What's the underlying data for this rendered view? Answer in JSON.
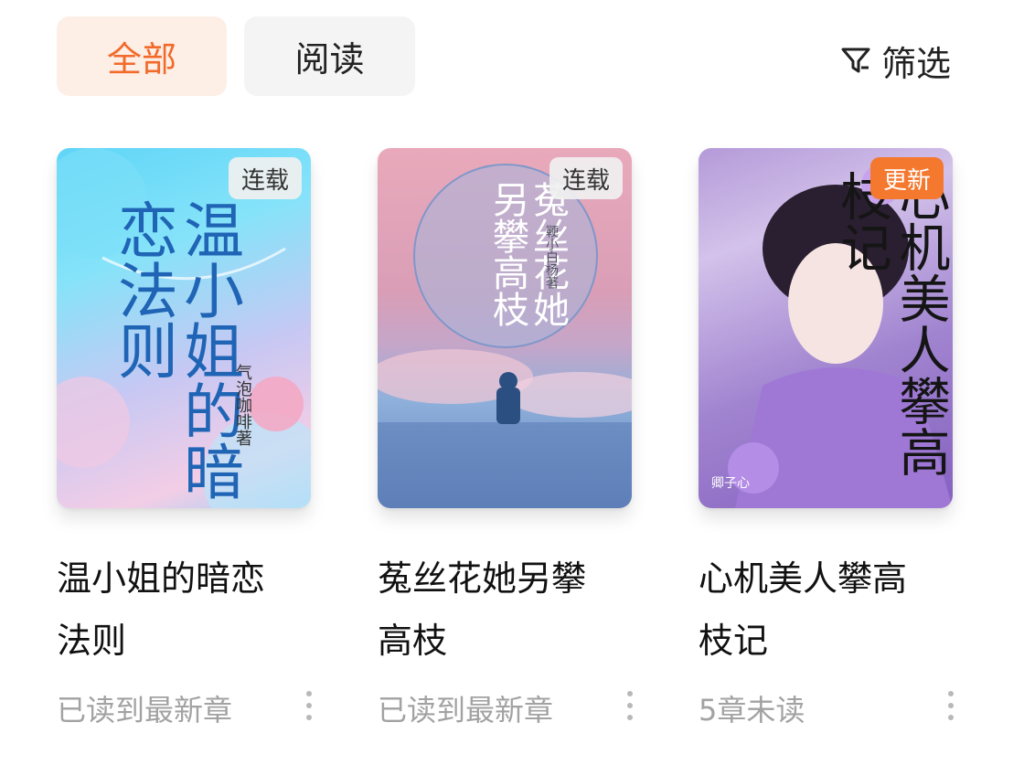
{
  "tabs": [
    {
      "label": "全部",
      "active": true
    },
    {
      "label": "阅读",
      "active": false
    }
  ],
  "filter": {
    "label": "筛选",
    "icon": "filter-icon"
  },
  "colors": {
    "accent": "#f26a2a",
    "update_badge": "#f5782f"
  },
  "books": [
    {
      "badge": "连载",
      "cover_title": "温小姐的暗恋法则",
      "cover_author": "气泡咖啡著",
      "title_line1": "温小姐的暗恋",
      "title_line2": "法则",
      "status": "已读到最新章"
    },
    {
      "badge": "连载",
      "cover_title": "菟丝花她另攀高枝",
      "cover_author": "鞕小白杨著",
      "title_line1": "菟丝花她另攀",
      "title_line2": "高枝",
      "status": "已读到最新章"
    },
    {
      "badge": "更新",
      "cover_title": "心机美人攀高枝记",
      "cover_author": "卿子心",
      "title_line1": "心机美人攀高",
      "title_line2": "枝记",
      "status": "5章未读"
    }
  ]
}
